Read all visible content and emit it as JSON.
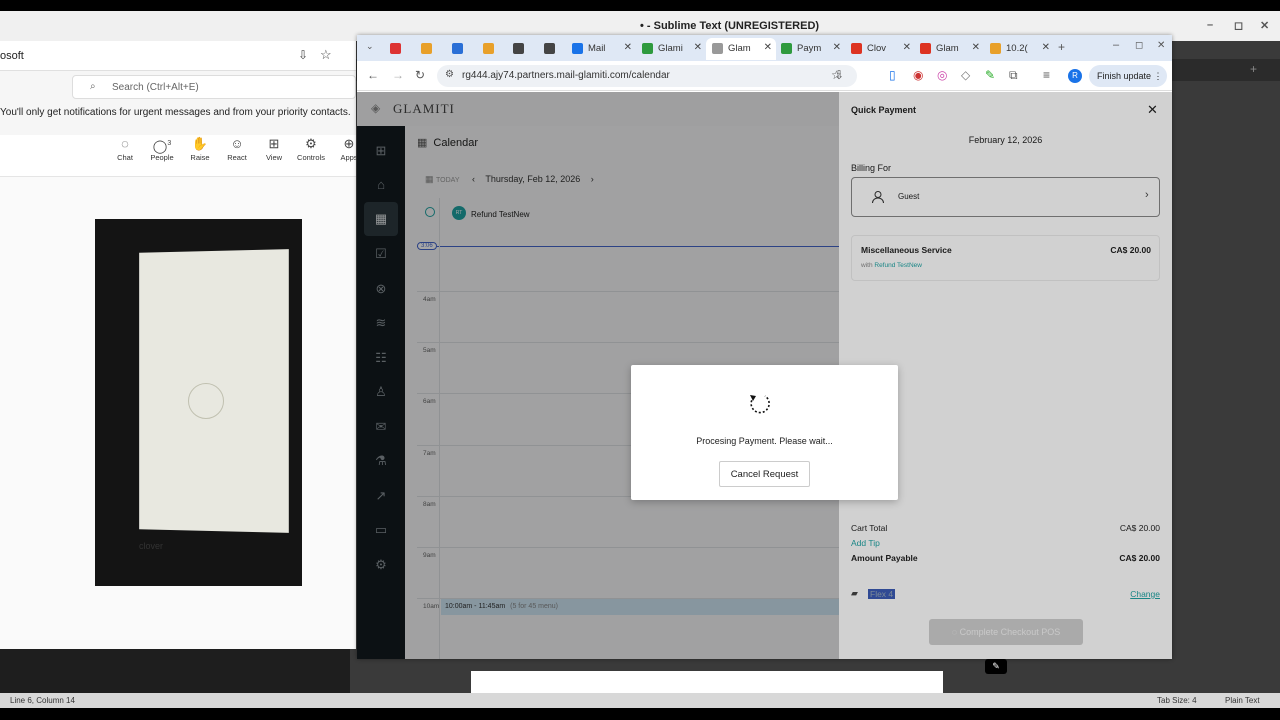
{
  "sublime": {
    "title": "• - Sublime Text (UNREGISTERED)",
    "status_left": "Line 6, Column 14",
    "status_tab": "Tab Size: 4",
    "status_syntax": "Plain Text"
  },
  "teams": {
    "app_label": "osoft",
    "search_placeholder": "Search (Ctrl+Alt+E)",
    "notice": "You'll only get notifications for urgent messages and from your priority contacts.",
    "tools": [
      {
        "label": "Chat",
        "icon": "chat-icon",
        "glyph": "💬"
      },
      {
        "label": "People",
        "icon": "people-icon",
        "glyph": "👤",
        "count": "3"
      },
      {
        "label": "Raise",
        "icon": "hand-icon",
        "glyph": "✋"
      },
      {
        "label": "React",
        "icon": "smile-icon",
        "glyph": "☺"
      },
      {
        "label": "View",
        "icon": "grid-icon",
        "glyph": "⊞"
      },
      {
        "label": "Controls",
        "icon": "controls-icon",
        "glyph": "⚙"
      },
      {
        "label": "Apps",
        "icon": "apps-icon",
        "glyph": "⊕"
      }
    ],
    "phone_logo": "clover"
  },
  "chrome": {
    "tabs": [
      {
        "label": "",
        "color": "#d33"
      },
      {
        "label": "",
        "color": "#e8a02a"
      },
      {
        "label": "",
        "color": "#2a6fd6"
      },
      {
        "label": "",
        "color": "#e8a02a"
      },
      {
        "label": "",
        "color": "#444"
      },
      {
        "label": "",
        "color": "#444"
      },
      {
        "label": "Mail",
        "color": "#1a73e8"
      },
      {
        "label": "Glami",
        "color": "#2e9a3e"
      },
      {
        "label": "Glam",
        "color": "#999"
      },
      {
        "label": "Paym",
        "color": "#2e9a3e"
      },
      {
        "label": "Clov",
        "color": "#d32"
      },
      {
        "label": "Glam",
        "color": "#d32"
      },
      {
        "label": "10.2(",
        "color": "#e8a02a"
      }
    ],
    "url": "rg444.ajy74.partners.mail-glamiti.com/calendar",
    "finish_update": "Finish update",
    "profile_initial": "R"
  },
  "app": {
    "logo": "GLAMITI",
    "calendar_title": "Calendar",
    "today": "TODAY",
    "date": "Thursday, Feb 12, 2026",
    "staff": "Refund TestNew",
    "staff_initials": "RT",
    "now": "3:06",
    "hours": [
      "4am",
      "5am",
      "6am",
      "7am",
      "8am",
      "9am",
      "10am"
    ],
    "appointment": "10:00am - 11:45am",
    "appointment_note": "(5 for 45 menu)"
  },
  "quick_payment": {
    "title": "Quick Payment",
    "date": "February 12, 2026",
    "billing_for": "Billing For",
    "guest": "Guest",
    "service": "Miscellaneous Service",
    "service_price": "CA$ 20.00",
    "with_label": "with",
    "staff": "Refund TestNew",
    "cart_total_label": "Cart Total",
    "cart_total": "CA$ 20.00",
    "add_tip": "Add Tip",
    "amount_payable_label": "Amount Payable",
    "amount_payable": "CA$ 20.00",
    "card": "Flex 4",
    "change": "Change",
    "checkout": "Complete Checkout POS"
  },
  "modal": {
    "message": "Procesing Payment. Please wait...",
    "cancel": "Cancel Request"
  }
}
